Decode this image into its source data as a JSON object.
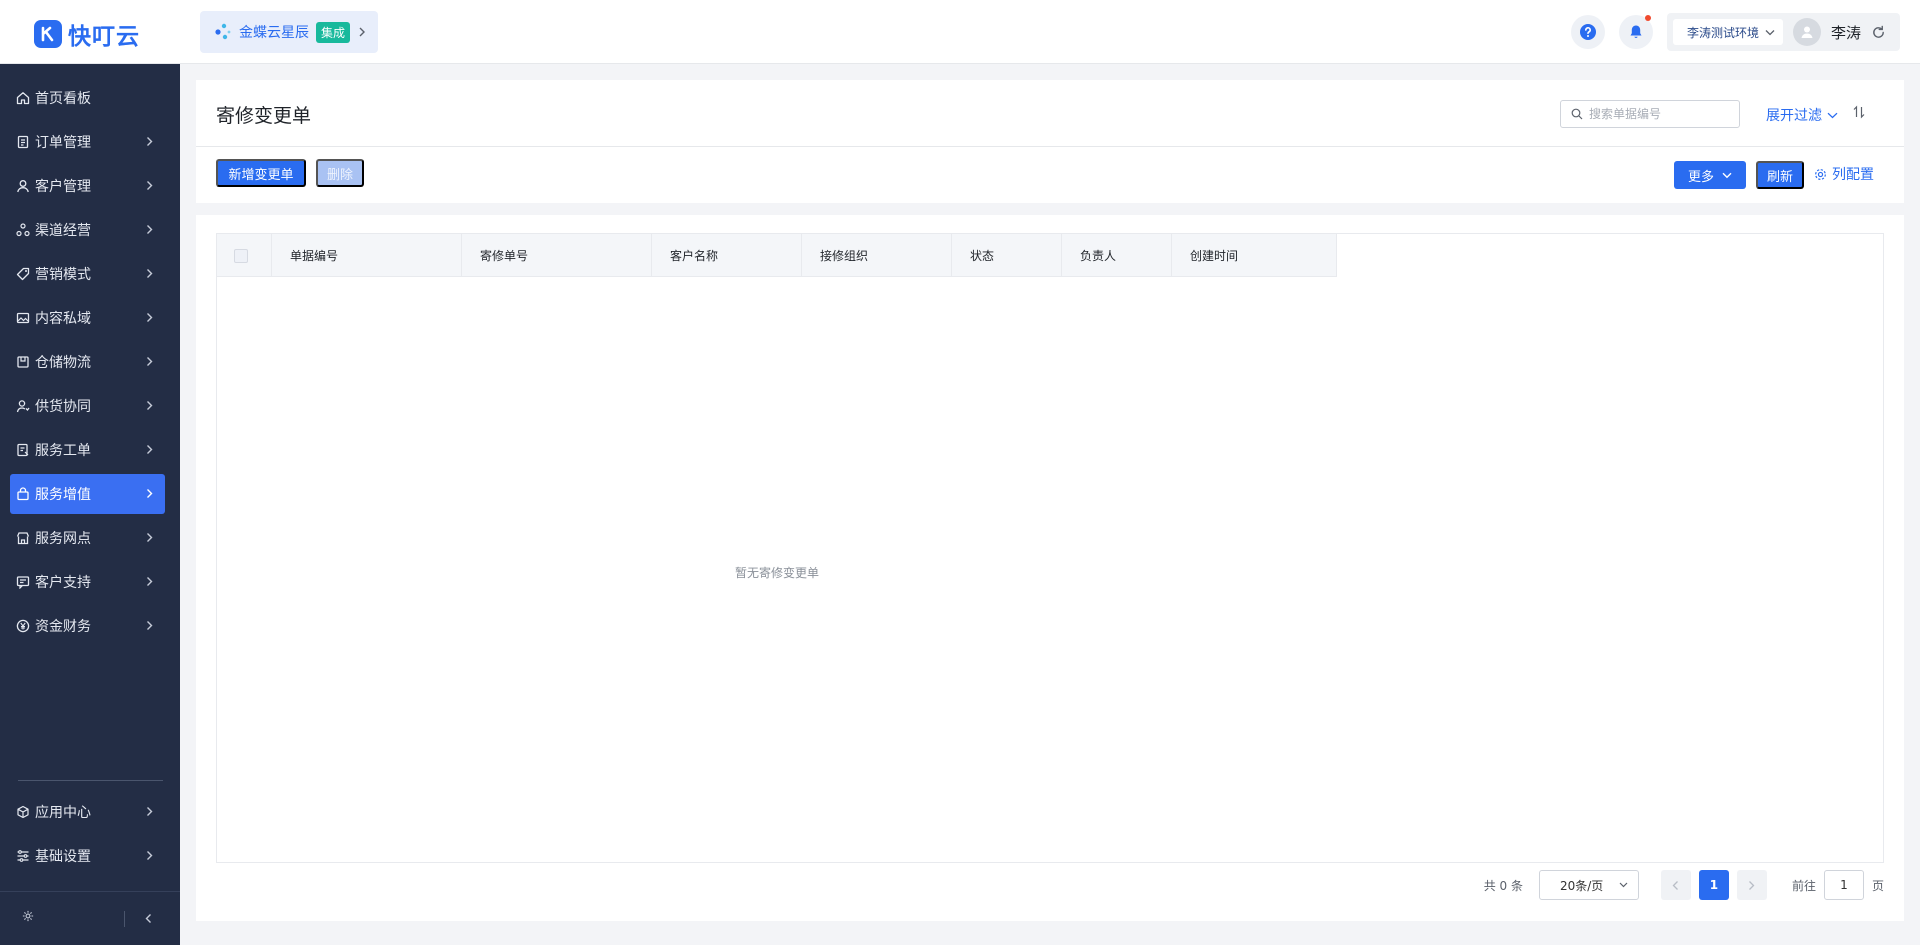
{
  "app": {
    "logo_text": "快叮云",
    "brand_color": "#2a6cf0"
  },
  "app_switch": {
    "name": "金蝶云星辰",
    "tag": "集成"
  },
  "topbar": {
    "help_icon": "help-icon",
    "bell_icon": "bell-icon",
    "environment": "李涛测试环境",
    "username": "李涛"
  },
  "sidebar": {
    "items": [
      {
        "label": "首页看板",
        "icon": "home-icon",
        "has_arrow": false
      },
      {
        "label": "订单管理",
        "icon": "order-icon",
        "has_arrow": true
      },
      {
        "label": "客户管理",
        "icon": "user-icon",
        "has_arrow": true
      },
      {
        "label": "渠道经营",
        "icon": "channel-icon",
        "has_arrow": true
      },
      {
        "label": "营销模式",
        "icon": "tag-icon",
        "has_arrow": true
      },
      {
        "label": "内容私域",
        "icon": "image-icon",
        "has_arrow": true
      },
      {
        "label": "仓储物流",
        "icon": "box-icon",
        "has_arrow": true
      },
      {
        "label": "供货协同",
        "icon": "supplier-icon",
        "has_arrow": true
      },
      {
        "label": "服务工单",
        "icon": "ticket-icon",
        "has_arrow": true
      },
      {
        "label": "服务增值",
        "icon": "bag-icon",
        "has_arrow": true,
        "active": true
      },
      {
        "label": "服务网点",
        "icon": "store-icon",
        "has_arrow": true
      },
      {
        "label": "客户支持",
        "icon": "support-icon",
        "has_arrow": true
      },
      {
        "label": "资金财务",
        "icon": "yuan-icon",
        "has_arrow": true
      }
    ],
    "bottom_items": [
      {
        "label": "应用中心",
        "icon": "cube-icon",
        "has_arrow": true
      },
      {
        "label": "基础设置",
        "icon": "settings-list-icon",
        "has_arrow": true
      }
    ]
  },
  "header": {
    "title": "寄修变更单",
    "search_placeholder": "搜索单据编号",
    "filter_label": "展开过滤",
    "add_button": "新增变更单",
    "delete_button": "删除",
    "more_button": "更多",
    "refresh_button": "刷新",
    "column_config": "列配置"
  },
  "table": {
    "columns": [
      "单据编号",
      "寄修单号",
      "客户名称",
      "接修组织",
      "状态",
      "负责人",
      "创建时间"
    ],
    "rows": [],
    "empty_text": "暂无寄修变更单"
  },
  "pagination": {
    "total": "共 0 条",
    "page_size": "20条/页",
    "current_page": "1",
    "goto_prefix": "前往",
    "goto_value": "1",
    "goto_suffix": "页"
  }
}
